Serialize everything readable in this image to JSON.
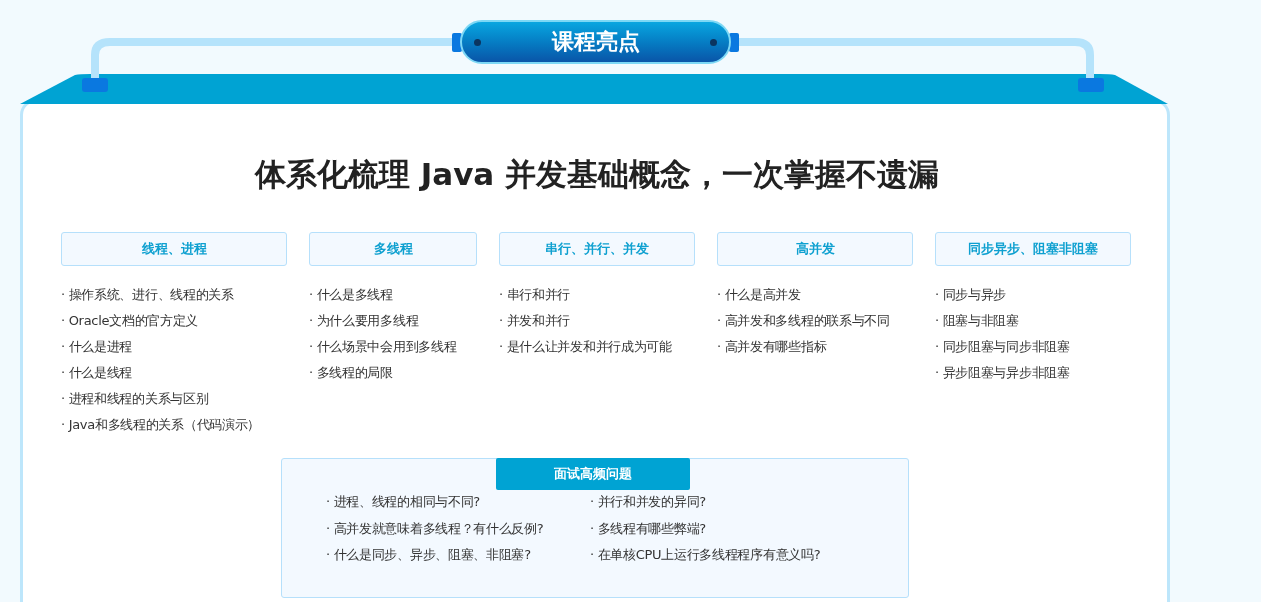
{
  "banner": {
    "title": "课程亮点"
  },
  "heading": "体系化梳理 Java 并发基础概念，一次掌握不遗漏",
  "topics": [
    {
      "title": "线程、进程",
      "items": [
        "· 操作系统、进行、线程的关系",
        "· Oracle文档的官方定义",
        "· 什么是进程",
        "· 什么是线程",
        "· 进程和线程的关系与区别",
        "· Java和多线程的关系（代码演示）"
      ]
    },
    {
      "title": "多线程",
      "items": [
        "· 什么是多线程",
        "· 为什么要用多线程",
        "· 什么场景中会用到多线程",
        "· 多线程的局限"
      ]
    },
    {
      "title": "串行、并行、并发",
      "items": [
        "· 串行和并行",
        "· 并发和并行",
        "· 是什么让并发和并行成为可能"
      ]
    },
    {
      "title": "高并发",
      "items": [
        "· 什么是高并发",
        "· 高并发和多线程的联系与不同",
        "· 高并发有哪些指标"
      ]
    },
    {
      "title": "同步异步、阻塞非阻塞",
      "items": [
        "· 同步与异步",
        "· 阻塞与非阻塞",
        "· 同步阻塞与同步非阻塞",
        "· 异步阻塞与异步非阻塞"
      ]
    }
  ],
  "interview": {
    "title": "面试高频问题",
    "columns": [
      {
        "items": [
          "· 进程、线程的相同与不同?",
          "· 高并发就意味着多线程？有什么反例?",
          "· 什么是同步、异步、阻塞、非阻塞?"
        ]
      },
      {
        "items": [
          "· 并行和并发的异同?",
          "· 多线程有哪些弊端?",
          "· 在单核CPU上运行多线程程序有意义吗?"
        ]
      }
    ]
  }
}
